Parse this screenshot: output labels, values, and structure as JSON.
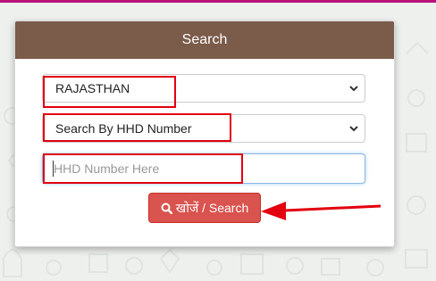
{
  "panel": {
    "title": "Search"
  },
  "state_select": {
    "selected": "RAJASTHAN"
  },
  "search_type_select": {
    "selected": "Search By HHD Number"
  },
  "hhd_input": {
    "value": "",
    "placeholder": "HHD Number Here"
  },
  "search_button": {
    "label": "खोजें / Search",
    "icon": "search-icon"
  },
  "colors": {
    "header_bg": "#7b5b49",
    "button_bg": "#d9534f",
    "highlight": "#e3000f",
    "top_accent": "#b8117a"
  }
}
